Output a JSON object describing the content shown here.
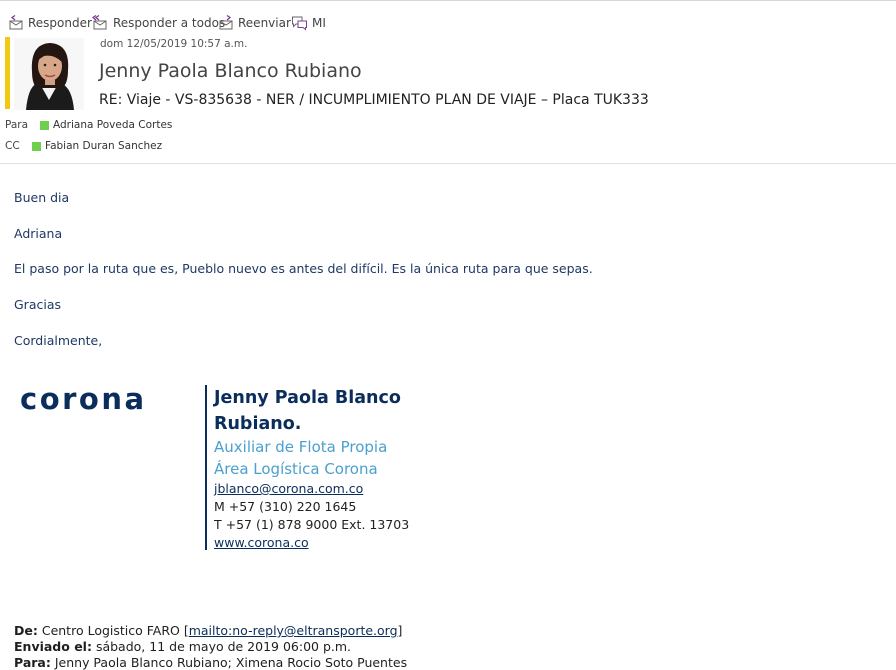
{
  "toolbar": {
    "reply": "Responder",
    "reply_all": "Responder a todos",
    "forward": "Reenviar",
    "im": "MI"
  },
  "header": {
    "date": "dom 12/05/2019 10:57 a.m.",
    "sender": "Jenny Paola Blanco Rubiano",
    "subject": "RE: Viaje - VS-835638 - NER / INCUMPLIMIENTO PLAN DE VIAJE – Placa TUK333",
    "to_label": "Para",
    "to_name": "Adriana Poveda Cortes",
    "cc_label": "CC",
    "cc_name": "Fabian Duran Sanchez",
    "presence_color": "#6fcf4f",
    "accent_color": "#f2c811"
  },
  "body": {
    "greeting": "Buen dia",
    "name": "Adriana",
    "message": "El paso por la ruta que es, Pueblo nuevo es antes del difícil.  Es la única ruta para que sepas.",
    "thanks": "Gracias",
    "closing": "Cordialmente,"
  },
  "signature": {
    "logo": "corona",
    "name_line1": "Jenny Paola Blanco",
    "name_line2": "Rubiano.",
    "role": "Auxiliar de Flota Propia",
    "area": "Área Logística Corona",
    "email": "jblanco@corona.com.co",
    "mobile": "M +57 (310) 220 1645",
    "phone": "T +57 (1) 878 9000 Ext. 13703",
    "website": "www.corona.co",
    "brand_color": "#0b2d5b",
    "accent_color": "#4aa0d0"
  },
  "quoted": {
    "from_label": "De:",
    "from_value": "Centro Logistico FARO [",
    "from_link": "mailto:no-reply@eltransporte.org",
    "from_end": "]",
    "sent_label": "Enviado el:",
    "sent_value": "sábado, 11 de mayo de 2019 06:00 p.m.",
    "to_label": "Para:",
    "to_value": "Jenny Paola Blanco Rubiano; Ximena Rocio Soto Puentes"
  }
}
